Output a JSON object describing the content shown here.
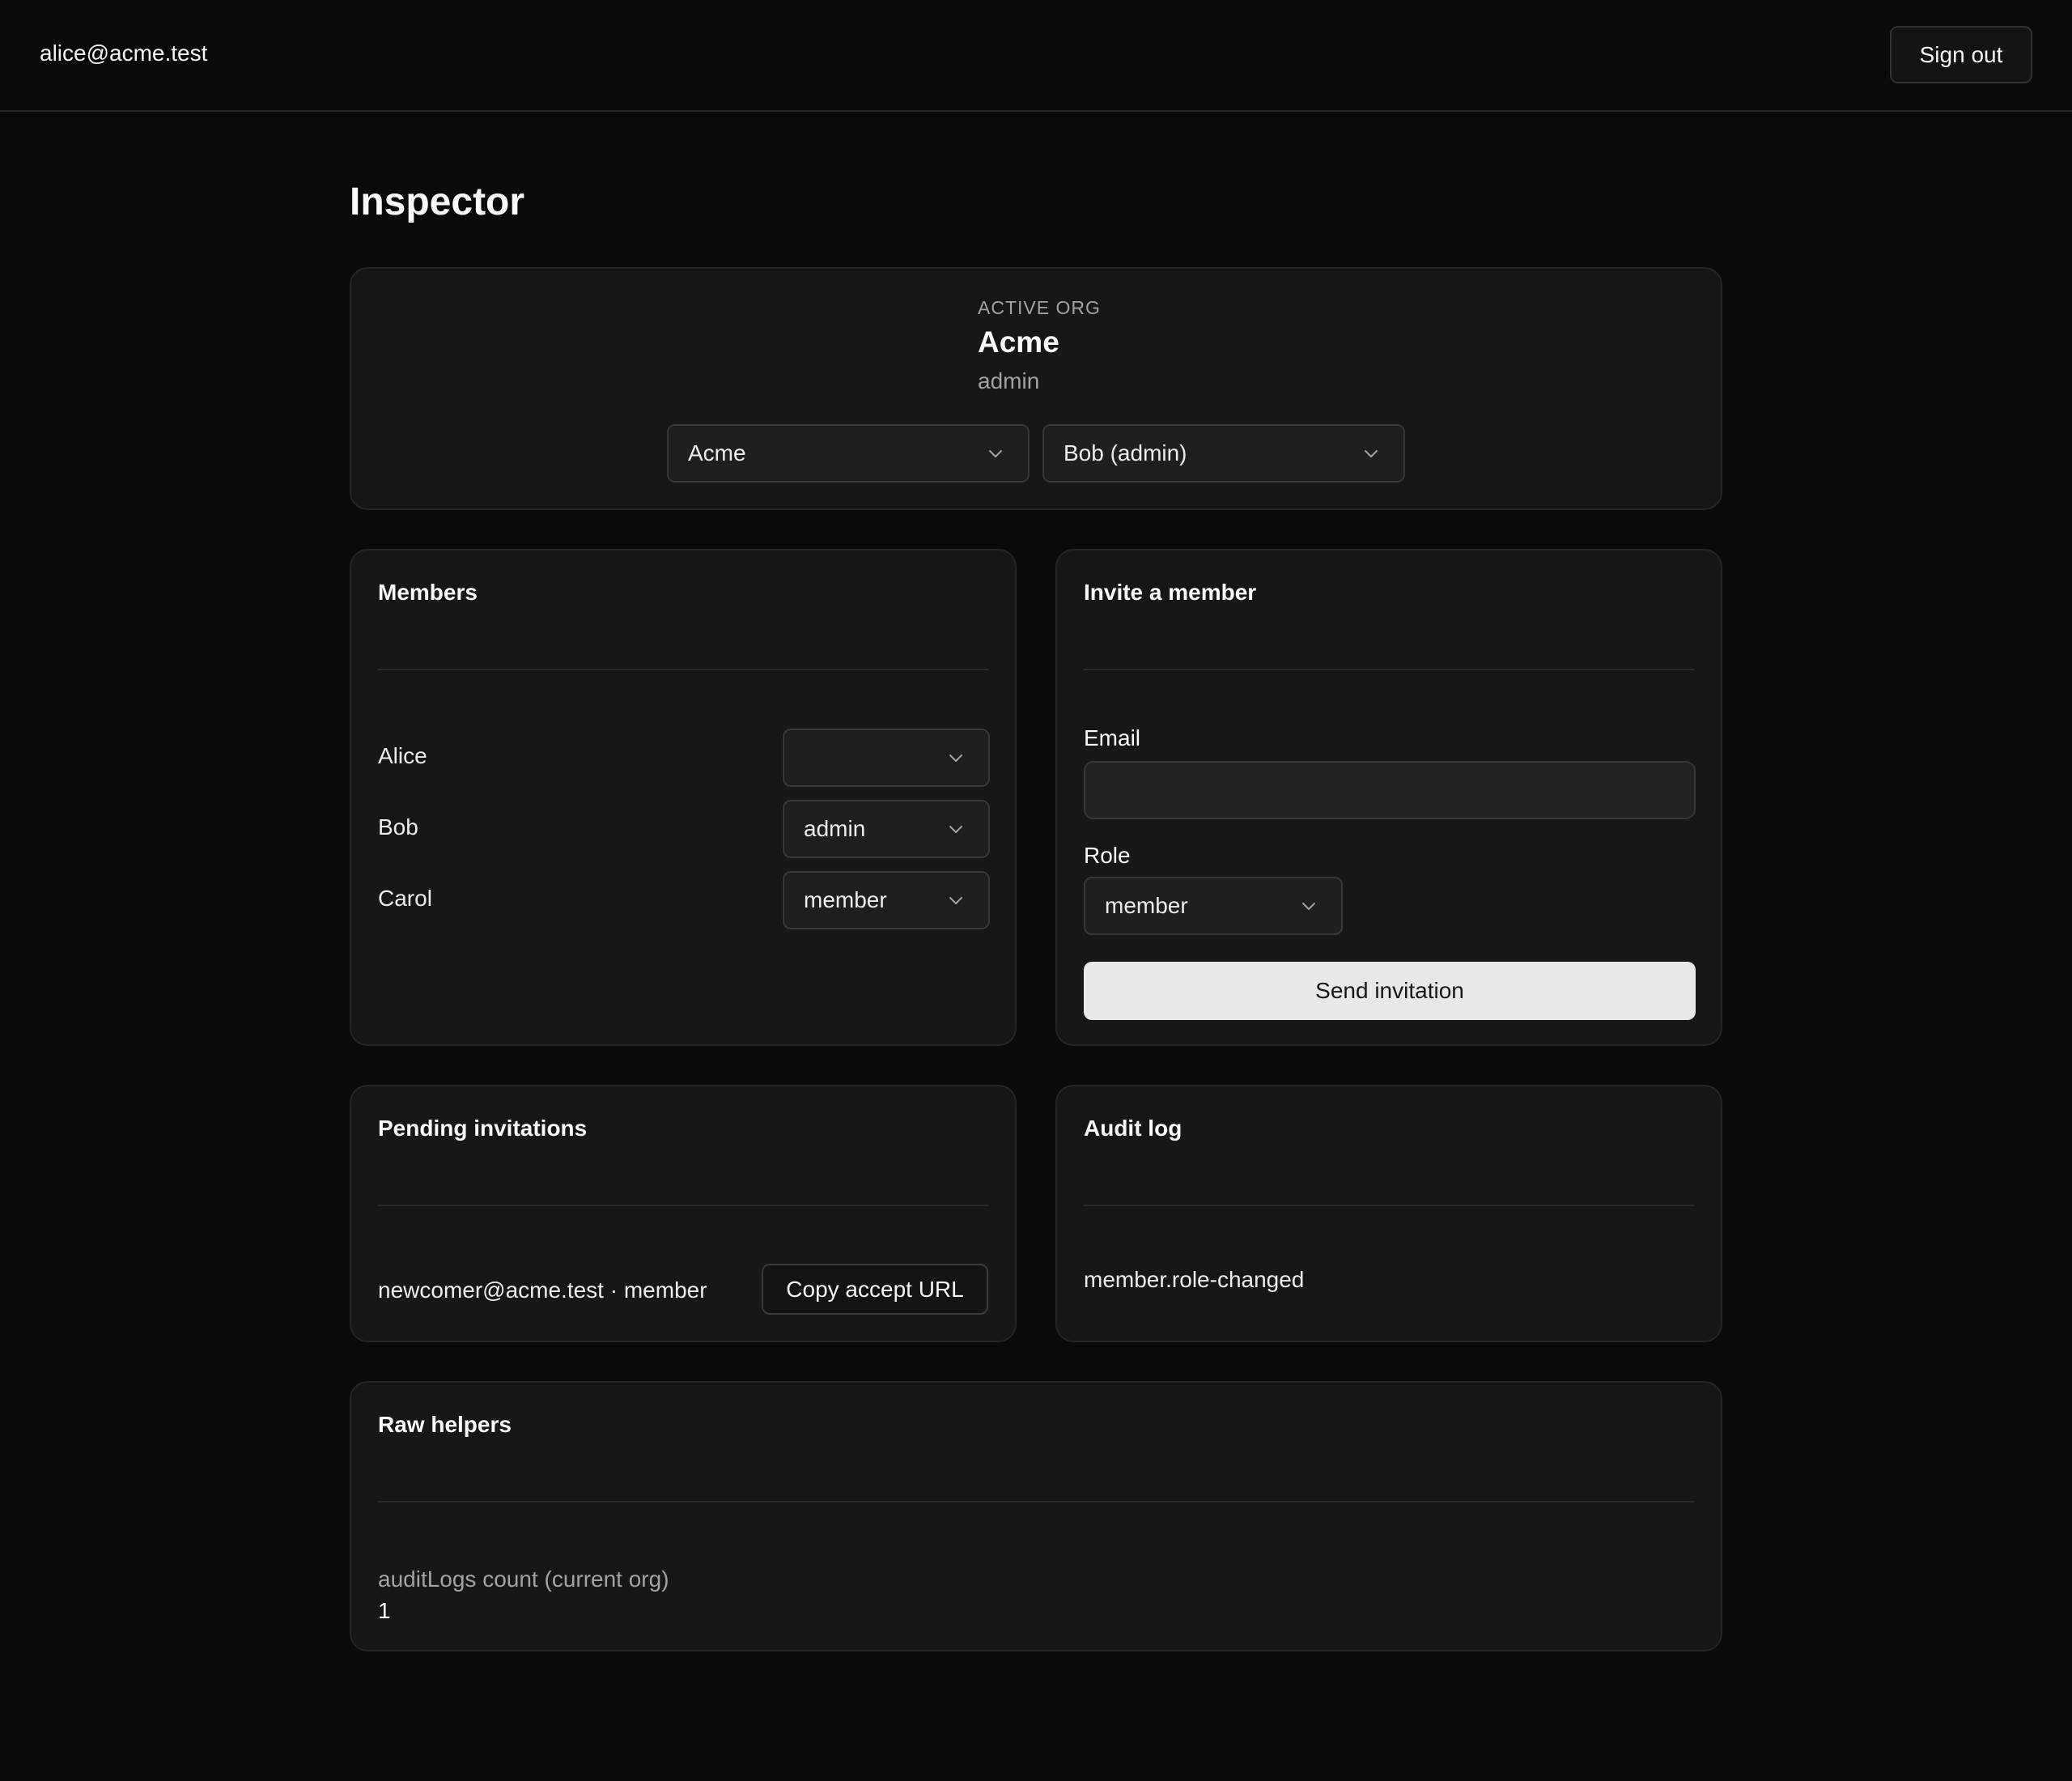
{
  "header": {
    "user_email": "alice@acme.test",
    "sign_out_label": "Sign out"
  },
  "page": {
    "title": "Inspector"
  },
  "active_org": {
    "label": "ACTIVE ORG",
    "name": "Acme",
    "role": "admin",
    "org_select_value": "Acme",
    "user_select_value": "Bob (admin)"
  },
  "members": {
    "title": "Members",
    "rows": [
      {
        "name": "Alice",
        "role": ""
      },
      {
        "name": "Bob",
        "role": "admin"
      },
      {
        "name": "Carol",
        "role": "member"
      }
    ]
  },
  "invite": {
    "title": "Invite a member",
    "email_label": "Email",
    "email_value": "",
    "role_label": "Role",
    "role_value": "member",
    "submit_label": "Send invitation"
  },
  "pending": {
    "title": "Pending invitations",
    "items": [
      {
        "text": "newcomer@acme.test · member",
        "action_label": "Copy accept URL"
      }
    ]
  },
  "audit": {
    "title": "Audit log",
    "entries": [
      "member.role-changed"
    ]
  },
  "raw_helpers": {
    "title": "Raw helpers",
    "label": "auditLogs count (current org)",
    "value": "1"
  }
}
